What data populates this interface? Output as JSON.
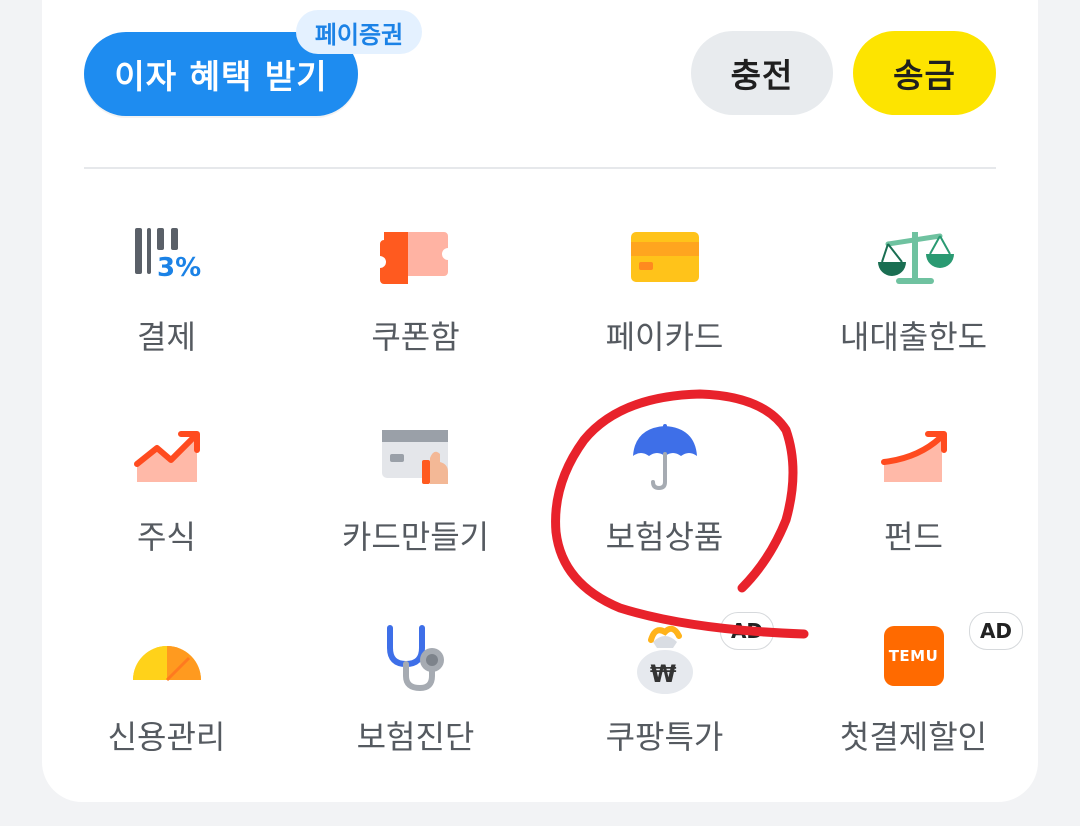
{
  "header": {
    "interest_button": "이자 혜택 받기",
    "interest_badge": "페이증권",
    "charge_button": "충전",
    "send_button": "송금"
  },
  "menu": [
    {
      "label": "결제",
      "icon": "barcode-3percent-icon"
    },
    {
      "label": "쿠폰함",
      "icon": "coupon-ticket-icon"
    },
    {
      "label": "페이카드",
      "icon": "yellow-card-icon"
    },
    {
      "label": "내대출한도",
      "icon": "scale-icon"
    },
    {
      "label": "주식",
      "icon": "stock-chart-icon"
    },
    {
      "label": "카드만들기",
      "icon": "card-hand-icon"
    },
    {
      "label": "보험상품",
      "icon": "umbrella-icon"
    },
    {
      "label": "펀드",
      "icon": "fund-chart-icon"
    },
    {
      "label": "신용관리",
      "icon": "credit-gauge-icon"
    },
    {
      "label": "보험진단",
      "icon": "stethoscope-icon"
    },
    {
      "label": "쿠팡특가",
      "icon": "money-bag-icon",
      "ad": "AD"
    },
    {
      "label": "첫결제할인",
      "icon": "temu-logo-icon",
      "ad": "AD",
      "logo_text": "TEMU"
    }
  ],
  "colors": {
    "primary_blue": "#1e8cf0",
    "kakao_yellow": "#fde400",
    "annotation_red": "#e8222b"
  }
}
